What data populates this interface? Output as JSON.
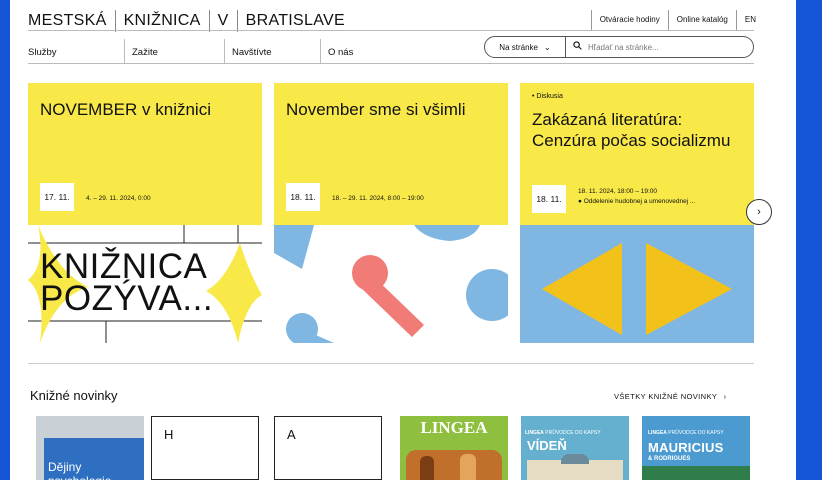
{
  "header": {
    "brand": [
      "MESTSKÁ",
      "KNIŽNICA",
      "V",
      "BRATISLAVE"
    ],
    "top_links": [
      "Otváracie hodiny",
      "Online katalóg",
      "EN"
    ],
    "nav": [
      "Služby",
      "Zažite",
      "Navštívte",
      "O nás"
    ],
    "scope_label": "Na stránke",
    "search_placeholder": "Hľadať na stránke..."
  },
  "events": [
    {
      "title": "NOVEMBER v knižnici",
      "day": "17. 11.",
      "range": "4. – 29. 11. 2024, 0:00",
      "image_text": [
        "KNIŽNICA",
        "POZÝVA..."
      ]
    },
    {
      "title": "November sme si všimli",
      "day": "18. 11.",
      "range": "18. – 29. 11. 2024, 8:00 – 19:00"
    },
    {
      "tag": "Diskusia",
      "title": "Zakázaná literatúra: Cenzúra počas socializmu",
      "day": "18. 11.",
      "range": "18. 11. 2024, 18:00 – 19:00",
      "location": "Oddelenie hudobnej a umenovednej ..."
    }
  ],
  "books_section": {
    "title": "Knižné novinky",
    "link": "VŠETKY KNIŽNÉ NOVINKY",
    "blank_letters": [
      "H",
      "A"
    ],
    "cover1_text": [
      "Dějiny",
      "psychologie"
    ],
    "cover_brand": "LINGEA",
    "cover5_title": "VÍDEŇ",
    "cover6_title": "MAURICIUS",
    "cover6_sub": "& RODRIGUES",
    "cover_series": "PRŮVODCE DO KAPSY"
  },
  "colors": {
    "yellow": "#f8e948",
    "blue": "#7fb6e2",
    "red": "#f07b77",
    "bg": "#1656d6"
  }
}
